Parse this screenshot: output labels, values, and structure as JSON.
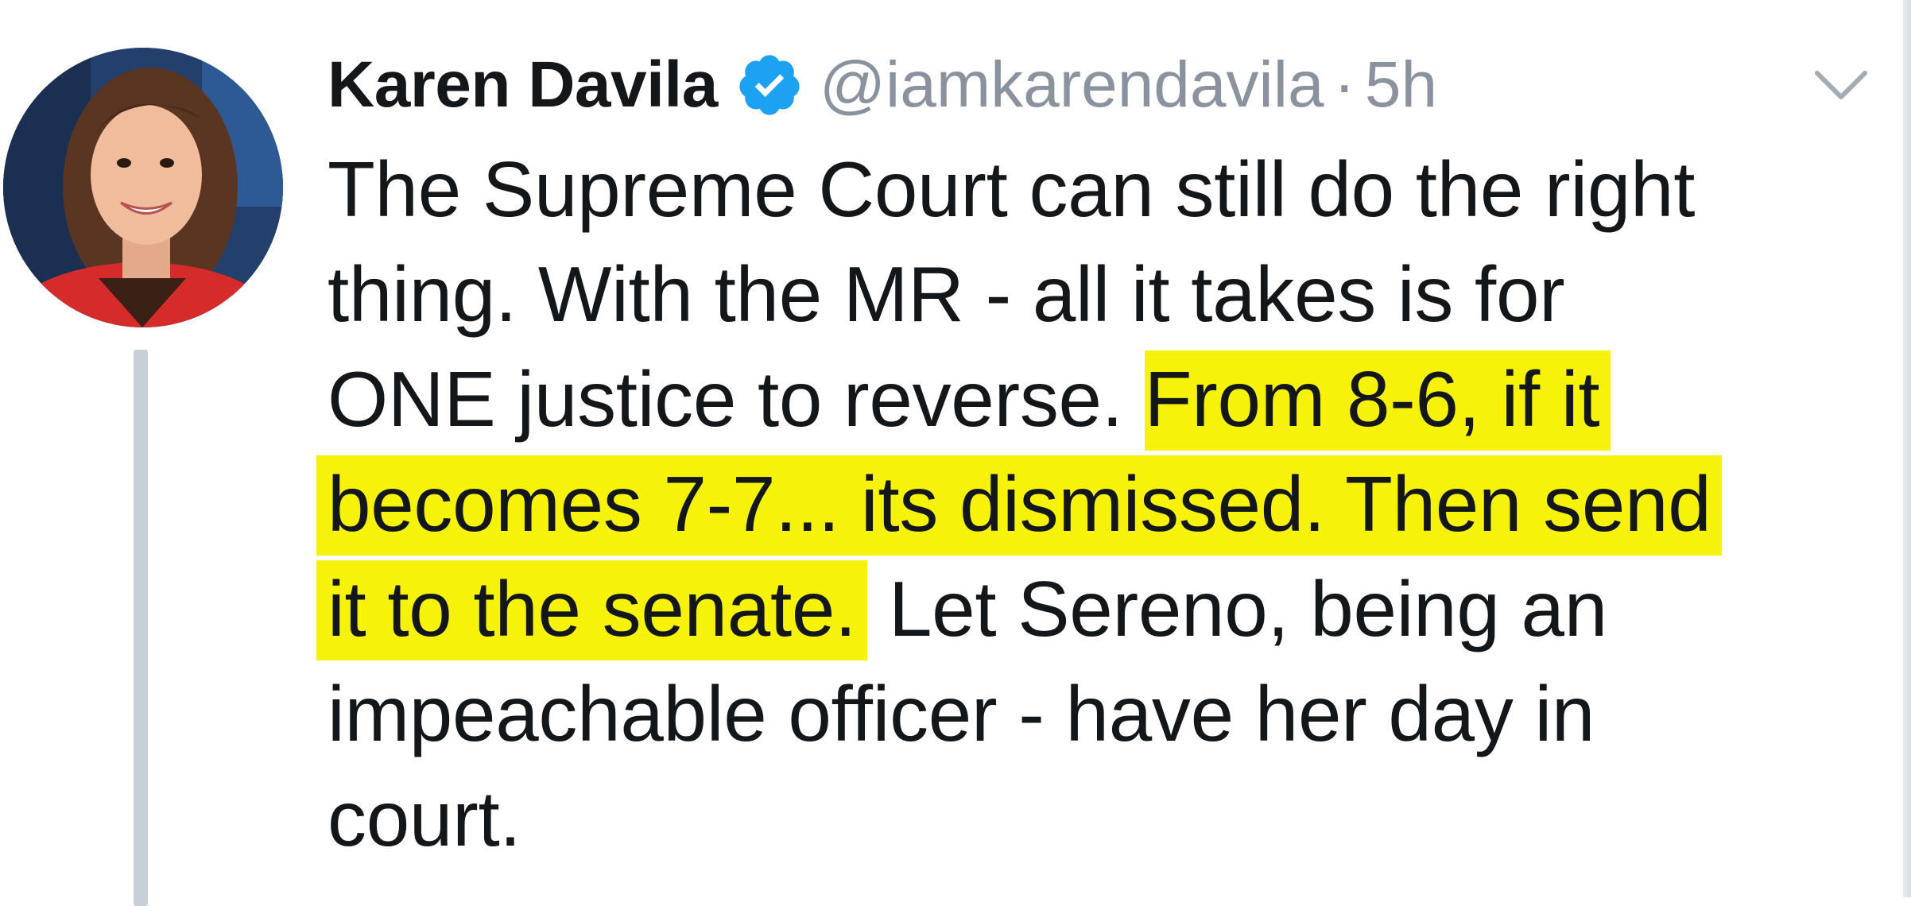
{
  "tweet": {
    "author_name": "Karen Davila",
    "handle": "@iamkarendavila",
    "separator": "·",
    "time": "5h",
    "lines": [
      {
        "normal": "The Supreme Court can still do the right",
        "highlight": ""
      },
      {
        "normal": "thing. With the MR - all it takes is for",
        "highlight": ""
      },
      {
        "normal": "ONE justice to reverse. ",
        "highlight": "From 8-6, if it"
      },
      {
        "normal": "",
        "highlight": "becomes 7-7... its dismissed. Then send"
      },
      {
        "normal": "Let Sereno, being an",
        "highlight": "it to the senate."
      },
      {
        "normal": "impeachable officer - have her day in",
        "highlight": ""
      },
      {
        "normal": "court.",
        "highlight": ""
      }
    ]
  },
  "icons": {
    "verified": "verified-badge-icon",
    "menu": "chevron-down-icon"
  },
  "colors": {
    "highlight": "#f6f20a",
    "verified": "#1da1f2",
    "muted_text": "#8a939d",
    "thread_line": "#c9cfd6"
  }
}
